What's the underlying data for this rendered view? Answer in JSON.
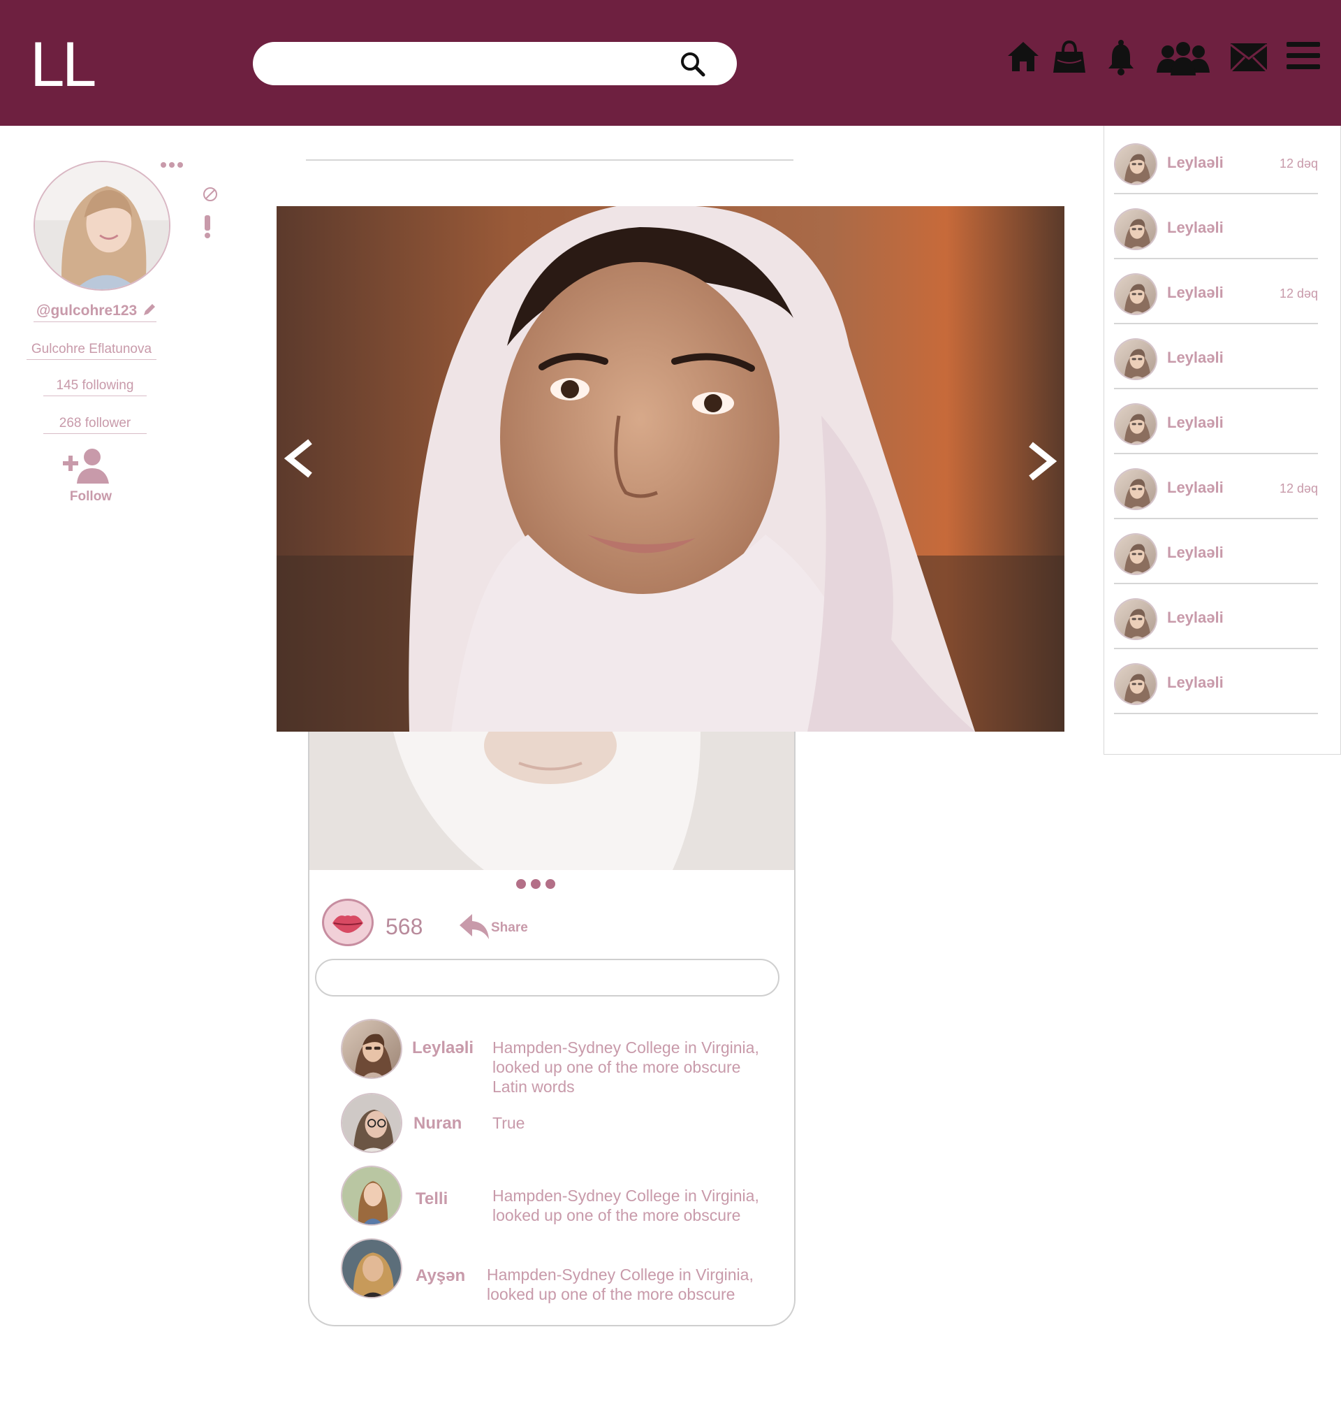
{
  "header": {
    "logo": "LL",
    "search": {
      "placeholder": "",
      "value": ""
    },
    "nav_icons": [
      "home-icon",
      "bag-icon",
      "bell-icon",
      "friends-icon",
      "mail-icon",
      "menu-icon"
    ]
  },
  "colors": {
    "header_bg": "#6e2040",
    "accent_text": "#c89aaa",
    "border": "#d6d6d6"
  },
  "profile": {
    "handle": "@gulcohre123",
    "full_name": "Gulcohre Eflatunova",
    "following": "145 following",
    "followers": "268 follower",
    "follow_label": "Follow"
  },
  "post": {
    "likes": "568",
    "share_label": "Share",
    "comment_input": {
      "placeholder": "",
      "value": ""
    },
    "comments": [
      {
        "name": "Leylaəli",
        "text": "Hampden-Sydney College in Virginia, looked up one of the more obscure Latin words"
      },
      {
        "name": "Nuran",
        "text": "True"
      },
      {
        "name": "Telli",
        "text": "Hampden-Sydney College in Virginia, looked up one of the more obscure"
      },
      {
        "name": "Ayşən",
        "text": "Hampden-Sydney College in Virginia, looked up one of the more obscure"
      }
    ]
  },
  "sidebar": {
    "items": [
      {
        "name": "Leylaəli",
        "time": "12 dəq"
      },
      {
        "name": "Leylaəli",
        "time": ""
      },
      {
        "name": "Leylaəli",
        "time": "12 dəq"
      },
      {
        "name": "Leylaəli",
        "time": ""
      },
      {
        "name": "Leylaəli",
        "time": ""
      },
      {
        "name": "Leylaəli",
        "time": "12 dəq"
      },
      {
        "name": "Leylaəli",
        "time": ""
      },
      {
        "name": "Leylaəli",
        "time": ""
      },
      {
        "name": "Leylaəli",
        "time": ""
      }
    ]
  }
}
